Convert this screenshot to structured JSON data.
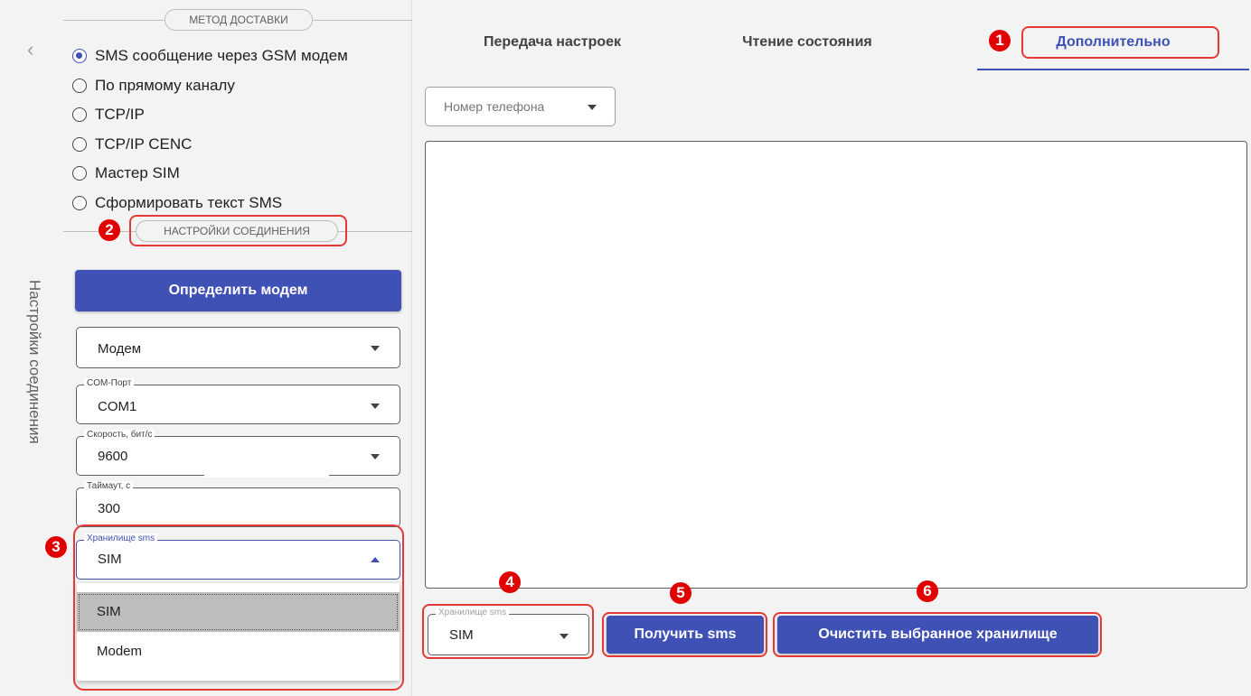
{
  "sidebar": {
    "collapse_glyph": "‹",
    "vertical_title": "Настройки соединения",
    "delivery_section_label": "МЕТОД ДОСТАВКИ",
    "delivery_options": [
      "SMS сообщение через GSM модем",
      "По прямому каналу",
      "TCP/IP",
      "TCP/IP CENC",
      "Мастер SIM",
      "Сформировать текст SMS"
    ],
    "delivery_selected_index": 0,
    "connection_section_label": "НАСТРОЙКИ СОЕДИНЕНИЯ",
    "detect_modem_button": "Определить модем",
    "device_select": {
      "value": "Модем"
    },
    "com_port": {
      "label": "COM-Порт",
      "value": "COM1"
    },
    "speed": {
      "label": "Скорость, бит/с",
      "value": "9600"
    },
    "timeout": {
      "label": "Таймаут, с",
      "value": "300"
    },
    "sms_storage": {
      "label": "Хранилище sms",
      "value": "SIM",
      "options": [
        "SIM",
        "Modem"
      ],
      "selected_option": "SIM"
    }
  },
  "main": {
    "tabs": [
      {
        "label": "Передача настроек",
        "active": false
      },
      {
        "label": "Чтение состояния",
        "active": false
      },
      {
        "label": "Дополнительно",
        "active": true
      }
    ],
    "phone_select": {
      "placeholder": "Номер телефона"
    },
    "sms_storage": {
      "label": "Хранилище sms",
      "value": "SIM"
    },
    "get_sms_button": "Получить sms",
    "clear_storage_button": "Очистить выбранное хранилище"
  },
  "annotations": [
    "1",
    "2",
    "3",
    "4",
    "5",
    "6"
  ],
  "colors": {
    "accent": "#3f51b5",
    "callout_red": "#e53935",
    "badge_red": "#e00000",
    "panel_bg": "#f3f3f3"
  },
  "icons": {
    "collapse": "chevron-left-icon",
    "dropdown": "caret-down-icon",
    "dropdown_open": "caret-up-icon",
    "radio_on": "radio-checked-icon",
    "radio_off": "radio-unchecked-icon"
  }
}
